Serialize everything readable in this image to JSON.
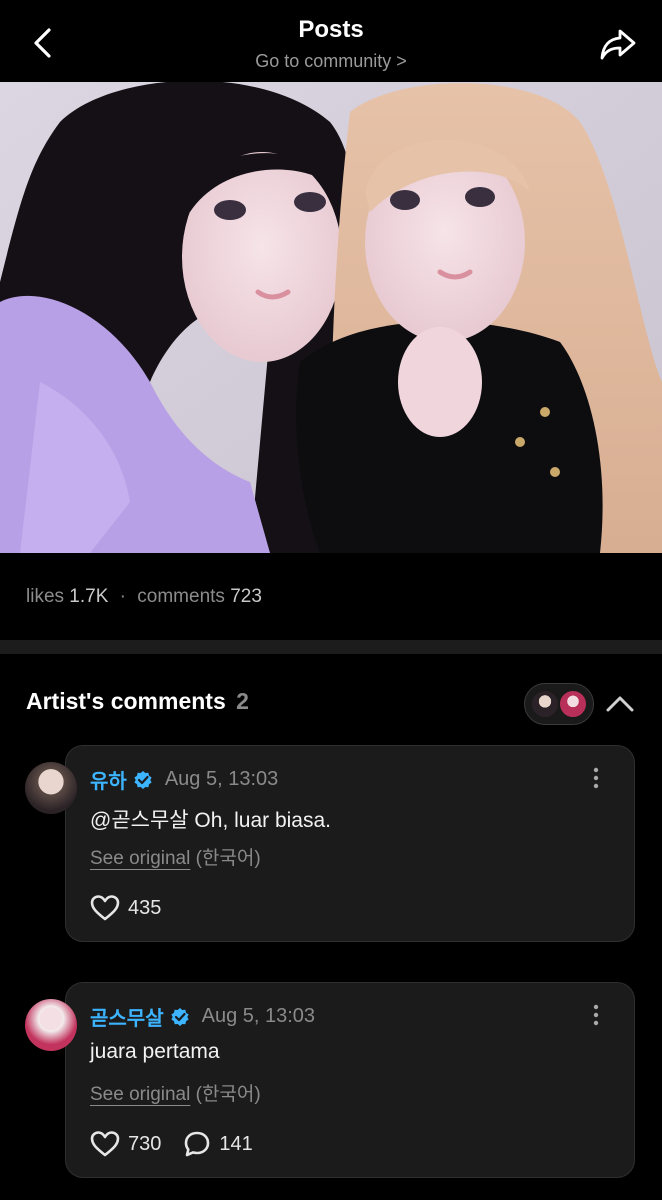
{
  "header": {
    "title": "Posts",
    "subtitle": "Go to community >"
  },
  "post": {
    "likes_label": "likes",
    "likes_count": "1.7K",
    "separator": "·",
    "comments_label": "comments",
    "comments_count": "723"
  },
  "artist_comments": {
    "title": "Artist's comments",
    "count": "2",
    "items": [
      {
        "name": "유하",
        "time": "Aug 5, 13:03",
        "text": "@곧스무살 Oh, luar biasa.",
        "see_original": "See original",
        "lang": "(한국어)",
        "likes": "435",
        "replies": null
      },
      {
        "name": "곧스무살",
        "time": "Aug 5, 13:03",
        "text": "juara pertama",
        "see_original": "See original",
        "lang": "(한국어)",
        "likes": "730",
        "replies": "141"
      }
    ]
  },
  "icons": {
    "back": "chevron-left-icon",
    "share": "share-arrow-icon",
    "verified": "verified-badge-icon",
    "more": "more-vertical-icon",
    "like": "heart-icon",
    "reply": "comment-bubble-icon",
    "collapse": "chevron-up-icon"
  },
  "colors": {
    "background": "#000000",
    "accent_name": "#3cb4ff",
    "card": "#1b1b1b",
    "muted": "#8a8a8a"
  }
}
